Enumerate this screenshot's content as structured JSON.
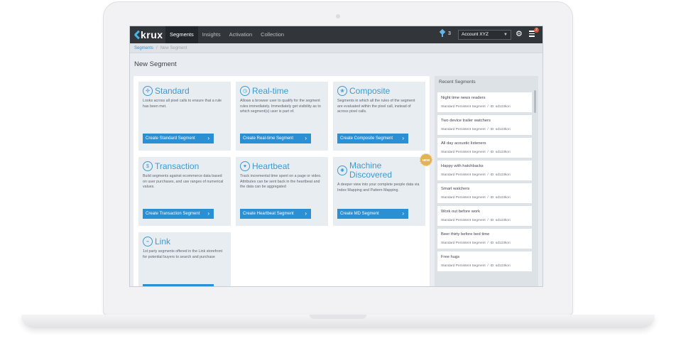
{
  "topbar": {
    "logo_text": "krux",
    "nav": [
      "Segments",
      "Insights",
      "Activation",
      "Collection"
    ],
    "pin_count": "3",
    "account": "Account XYZ",
    "alerts_count": "2"
  },
  "breadcrumb": {
    "root": "Segments",
    "separator": "/",
    "current": "New Segment"
  },
  "page_title": "New Segment",
  "cards": [
    {
      "icon": "standard-icon",
      "glyph": "✣",
      "title": "Standard",
      "desc": "Looks across all pixel calls to ensure that a rule has been met.",
      "button": "Create Standard Segment",
      "badge": ""
    },
    {
      "icon": "realtime-icon",
      "glyph": "◷",
      "title": "Real-time",
      "desc": "Allows a browser user to qualify for the segment rules immediately. Immediately get visibility as to which segment(s) user is part of.",
      "button": "Create Real-time Segment",
      "badge": ""
    },
    {
      "icon": "composite-icon",
      "glyph": "❀",
      "title": "Composite",
      "desc": "Segments in which all the rules of the segment are evaluated within the pixel call, instead of across pixel calls.",
      "button": "Create Composite Segment",
      "badge": ""
    },
    {
      "icon": "transaction-icon",
      "glyph": "$",
      "title": "Transaction",
      "desc": "Build segments against ecommerce data based on user purchases, and  use ranges of numerical values.",
      "button": "Create Transaction Segment",
      "badge": ""
    },
    {
      "icon": "heartbeat-icon",
      "glyph": "♥",
      "title": "Heartbeat",
      "desc": "Track incremental time spent on a page or video. Attributes can be sent back in the heartbeat and the data can be aggregated",
      "button": "Create Heartbeat Segment",
      "badge": ""
    },
    {
      "icon": "machine-discovered-icon",
      "glyph": "✺",
      "title": "Machine Discovered",
      "desc": "A deeper view into your complete people data via Index Mapping and Pattern Mapping.",
      "button": "Create MD Segment",
      "badge": "NEW"
    },
    {
      "icon": "link-icon",
      "glyph": "⌁",
      "title": "Link",
      "desc": "1st party segments offered in the Link storefront for potential buyers to search and purchase",
      "button": "",
      "badge": ""
    }
  ],
  "recent": {
    "title": "Recent Segments",
    "items": [
      {
        "name": "Night time news readers",
        "type": "Standard Persistent Segment",
        "id": "ID: sd123kon"
      },
      {
        "name": "Two device trailer watchers",
        "type": "Standard Persistent Segment",
        "id": "ID: sd123kon"
      },
      {
        "name": "All day acoustic listeners",
        "type": "Standard Persistent Segment",
        "id": "ID: sd123kon"
      },
      {
        "name": "Happy with hatchbacks",
        "type": "Standard Persistent Segment",
        "id": "ID: sd123kon"
      },
      {
        "name": "Smart watchers",
        "type": "Standard Persistent Segment",
        "id": "ID: sd123kon"
      },
      {
        "name": "Work out before work",
        "type": "Standard Persistent Segment",
        "id": "ID: sd123kon"
      },
      {
        "name": "Beer thirty before bed time",
        "type": "Standard Persistent Segment",
        "id": "ID: sd123kon"
      },
      {
        "name": "Free hugs",
        "type": "Standard Persistent Segment",
        "id": "ID: sd123kon"
      }
    ]
  }
}
